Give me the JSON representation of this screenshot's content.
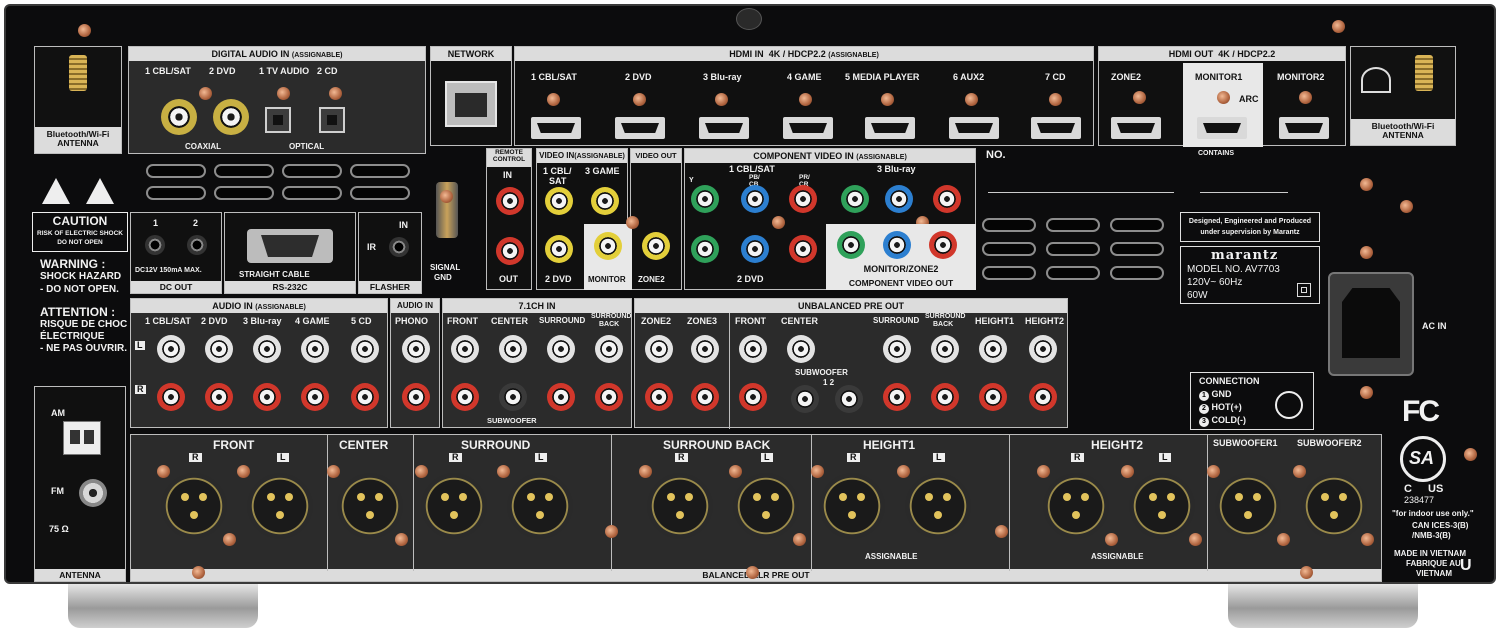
{
  "digital_audio_in": {
    "title": "DIGITAL AUDIO IN",
    "assignable": "(ASSIGNABLE)",
    "inputs": [
      "1 CBL/SAT",
      "2 DVD",
      "1 TV AUDIO",
      "2 CD"
    ],
    "coaxial": "COAXIAL",
    "optical": "OPTICAL"
  },
  "network": {
    "title": "NETWORK"
  },
  "hdmi_in": {
    "title": "HDMI IN",
    "spec": "4K / HDCP2.2",
    "assignable": "(ASSIGNABLE)",
    "inputs": [
      "1 CBL/SAT",
      "2 DVD",
      "3 Blu-ray",
      "4 GAME",
      "5 MEDIA PLAYER",
      "6 AUX2",
      "7 CD"
    ]
  },
  "hdmi_out": {
    "title": "HDMI OUT",
    "spec": "4K / HDCP2.2",
    "zone2": "ZONE2",
    "monitor1": "MONITOR1",
    "monitor2": "MONITOR2",
    "arc": "ARC",
    "contains": "CONTAINS"
  },
  "antenna_left": {
    "line1": "Bluetooth/Wi-Fi",
    "line2": "ANTENNA"
  },
  "antenna_right": {
    "line1": "Bluetooth/Wi-Fi",
    "line2": "ANTENNA"
  },
  "caution": {
    "title": "CAUTION",
    "line1": "RISK OF ELECTRIC SHOCK",
    "line2": "DO NOT OPEN"
  },
  "warning": {
    "title": "WARNING :",
    "line1": "SHOCK HAZARD",
    "line2": "- DO NOT OPEN."
  },
  "attention": {
    "title": "ATTENTION :",
    "line1": "RISQUE DE CHOC",
    "line2": "ÉLECTRIQUE",
    "line3": "- NE PAS OUVRIR."
  },
  "dc_out": {
    "title": "DC OUT",
    "ports": [
      "1",
      "2"
    ],
    "spec": "DC12V 150mA MAX."
  },
  "rs232c": {
    "title": "RS-232C",
    "cable": "STRAIGHT CABLE"
  },
  "flasher": {
    "title": "FLASHER",
    "in": "IN",
    "ir": "IR"
  },
  "signal_gnd": {
    "line1": "SIGNAL",
    "line2": "GND"
  },
  "remote_control": {
    "title1": "REMOTE",
    "title2": "CONTROL",
    "in": "IN",
    "out": "OUT"
  },
  "video_in": {
    "title": "VIDEO IN",
    "assignable": "(ASSIGNABLE)",
    "inputs": [
      "1 CBL/",
      "SAT",
      "3 GAME",
      "2 DVD"
    ]
  },
  "video_out": {
    "title": "VIDEO OUT",
    "monitor": "MONITOR",
    "zone2": "ZONE2"
  },
  "component_in": {
    "title": "COMPONENT VIDEO IN",
    "assignable": "(ASSIGNABLE)",
    "groups": [
      "1 CBL/SAT",
      "3 Blu-ray",
      "2 DVD"
    ],
    "y": "Y",
    "pb": "PB/",
    "cb": "CB",
    "pr": "PR/",
    "cr": "CR"
  },
  "component_out": {
    "title": "COMPONENT VIDEO OUT",
    "monitor_zone2": "MONITOR/ZONE2"
  },
  "model_plate": {
    "no": "NO.",
    "designed1": "Designed, Engineered and Produced",
    "designed2": "under supervision by Marantz",
    "brand": "marantz",
    "model": "MODEL NO. AV7703",
    "voltage": "120V~  60Hz",
    "watt": "60W"
  },
  "audio_in": {
    "title": "AUDIO IN",
    "assignable": "(ASSIGNABLE)",
    "inputs": [
      "1 CBL/SAT",
      "2 DVD",
      "3 Blu-ray",
      "4 GAME",
      "5 CD"
    ],
    "l": "L",
    "r": "R"
  },
  "phono": {
    "title": "AUDIO IN",
    "label": "PHONO"
  },
  "ch71_in": {
    "title": "7.1CH IN",
    "channels": [
      "FRONT",
      "CENTER",
      "SURROUND",
      "SURROUND",
      "BACK"
    ],
    "subwoofer": "SUBWOOFER"
  },
  "unbalanced_pre_out": {
    "title": "UNBALANCED PRE OUT",
    "channels": [
      "ZONE2",
      "ZONE3",
      "FRONT",
      "CENTER",
      "SURROUND",
      "SURROUND",
      "BACK",
      "HEIGHT1",
      "HEIGHT2"
    ],
    "subwoofer": "SUBWOOFER",
    "sub_nums": "1  2"
  },
  "ac_in": {
    "label": "AC IN"
  },
  "connection": {
    "title": "CONNECTION",
    "gnd": "GND",
    "hot": "HOT(+)",
    "cold": "COLD(-)",
    "n1": "1",
    "n2": "2",
    "n3": "3"
  },
  "certification": {
    "fc": "FC",
    "csa": "SA",
    "c": "C",
    "us": "US",
    "number": "238477",
    "indoor": "\"for indoor use only.\"",
    "ices1": "CAN ICES-3(B)",
    "ices2": "/NMB-3(B)",
    "made1": "MADE IN VIETNAM",
    "made2": "FABRIQUE AU",
    "made3": "VIETNAM",
    "ul": "U"
  },
  "antenna_tuner": {
    "am": "AM",
    "fm": "FM",
    "ohm": "75 Ω",
    "title": "ANTENNA"
  },
  "balanced_xlr": {
    "title": "BALANCED XLR PRE OUT",
    "groups": [
      "FRONT",
      "CENTER",
      "SURROUND",
      "SURROUND BACK",
      "HEIGHT1",
      "HEIGHT2",
      "SUBWOOFER1",
      "SUBWOOFER2"
    ],
    "r": "R",
    "l": "L",
    "assignable": "ASSIGNABLE"
  },
  "colors": {
    "panel": "#0c0c0d",
    "label_bg": "#dcdcdc",
    "screw": "#c07a52"
  }
}
